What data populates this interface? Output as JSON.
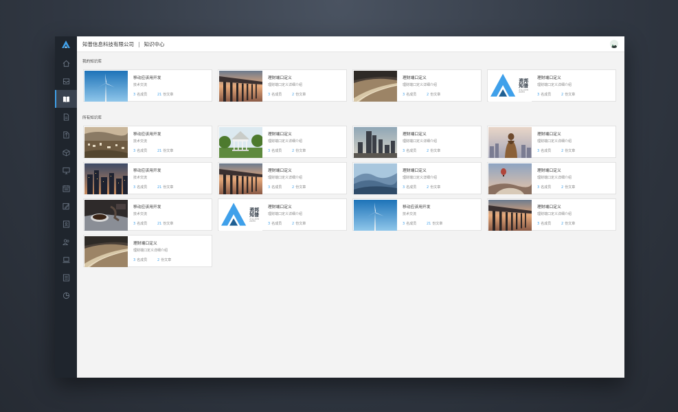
{
  "app": {
    "company": "知普信息科技有限公司",
    "separator": "|",
    "section": "知识中心"
  },
  "sidebar": {
    "items": [
      {
        "icon": "home-icon"
      },
      {
        "icon": "inbox-icon"
      },
      {
        "icon": "book-icon"
      },
      {
        "icon": "document-icon"
      },
      {
        "icon": "transfer-icon"
      },
      {
        "icon": "cube-icon"
      },
      {
        "icon": "monitor-icon"
      },
      {
        "icon": "calendar-icon"
      },
      {
        "icon": "edit-icon"
      },
      {
        "icon": "user-card-icon"
      },
      {
        "icon": "team-icon"
      },
      {
        "icon": "laptop-icon"
      },
      {
        "icon": "list-icon"
      },
      {
        "icon": "pie-chart-icon"
      }
    ]
  },
  "my_kb": {
    "label": "我的知识库",
    "cards": [
      {
        "image": "wind-turbine",
        "title": "移动应该用开发",
        "subtitle": "技术交流",
        "members": "3",
        "members_label": "名成员",
        "articles": "21",
        "articles_label": "份文章"
      },
      {
        "image": "pier",
        "title": "理财端口定义",
        "subtitle": "理财端口定义详细介绍",
        "members": "3",
        "members_label": "名成员",
        "articles": "2",
        "articles_label": "份文章"
      },
      {
        "image": "road-hills",
        "title": "理财端口定义",
        "subtitle": "理财端口定义详细介绍",
        "members": "3",
        "members_label": "名成员",
        "articles": "2",
        "articles_label": "份文章"
      },
      {
        "image": "brand-logo",
        "title": "理财端口定义",
        "subtitle": "理财端口定义详细介绍",
        "members": "3",
        "members_label": "名成员",
        "articles": "2",
        "articles_label": "份文章"
      }
    ]
  },
  "all_kb": {
    "label": "所有知识库",
    "cards": [
      {
        "image": "city-hills",
        "title": "移动应该用开发",
        "subtitle": "技术交流",
        "members": "3",
        "members_label": "名成员",
        "articles": "21",
        "articles_label": "份文章"
      },
      {
        "image": "gazebo",
        "title": "理财端口定义",
        "subtitle": "理财端口定义详细介绍",
        "members": "3",
        "members_label": "名成员",
        "articles": "2",
        "articles_label": "份文章"
      },
      {
        "image": "skyline",
        "title": "理财端口定义",
        "subtitle": "理财端口定义详细介绍",
        "members": "3",
        "members_label": "名成员",
        "articles": "2",
        "articles_label": "份文章"
      },
      {
        "image": "woman-city",
        "title": "理财端口定义",
        "subtitle": "理财端口定义详细介绍",
        "members": "3",
        "members_label": "名成员",
        "articles": "2",
        "articles_label": "份文章"
      },
      {
        "image": "city-dusk",
        "title": "移动应该用开发",
        "subtitle": "技术交流",
        "members": "3",
        "members_label": "名成员",
        "articles": "21",
        "articles_label": "份文章"
      },
      {
        "image": "pier",
        "title": "理财端口定义",
        "subtitle": "理财端口定义详细介绍",
        "members": "3",
        "members_label": "名成员",
        "articles": "2",
        "articles_label": "份文章"
      },
      {
        "image": "mountains",
        "title": "理财端口定义",
        "subtitle": "理财端口定义详细介绍",
        "members": "3",
        "members_label": "名成员",
        "articles": "2",
        "articles_label": "份文章"
      },
      {
        "image": "balloon",
        "title": "理财端口定义",
        "subtitle": "理财端口定义详细介绍",
        "members": "3",
        "members_label": "名成员",
        "articles": "2",
        "articles_label": "份文章"
      },
      {
        "image": "coffee",
        "title": "移动应该用开发",
        "subtitle": "技术交流",
        "members": "3",
        "members_label": "名成员",
        "articles": "21",
        "articles_label": "份文章"
      },
      {
        "image": "brand-logo",
        "title": "理财端口定义",
        "subtitle": "理财端口定义详细介绍",
        "members": "3",
        "members_label": "名成员",
        "articles": "2",
        "articles_label": "份文章"
      },
      {
        "image": "wind-turbine",
        "title": "移动应该用开发",
        "subtitle": "技术交流",
        "members": "3",
        "members_label": "名成员",
        "articles": "21",
        "articles_label": "份文章"
      },
      {
        "image": "pier",
        "title": "理财端口定义",
        "subtitle": "理财端口定义详细介绍",
        "members": "3",
        "members_label": "名成员",
        "articles": "2",
        "articles_label": "份文章"
      },
      {
        "image": "road-hills",
        "title": "理财端口定义",
        "subtitle": "理财端口定义详细介绍",
        "members": "3",
        "members_label": "名成员",
        "articles": "2",
        "articles_label": "份文章"
      }
    ]
  },
  "brand": {
    "name": "资邦知普",
    "sub": "ZILLION AKMI"
  },
  "colors": {
    "accent": "#3fa0ea",
    "sidebar": "#1f252d",
    "background": "#f3f3f3"
  }
}
